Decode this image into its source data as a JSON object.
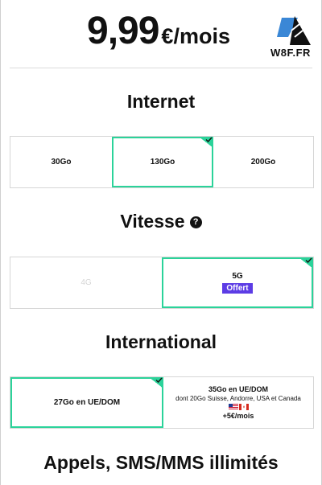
{
  "plan": {
    "price": "9,99",
    "unit": "€/mois"
  },
  "brand": {
    "logo_text": "W8F.FR"
  },
  "internet": {
    "title": "Internet",
    "options": [
      {
        "label": "30Go",
        "selected": false
      },
      {
        "label": "130Go",
        "selected": true
      },
      {
        "label": "200Go",
        "selected": false
      }
    ]
  },
  "speed": {
    "title": "Vitesse",
    "help_icon": "?",
    "options": [
      {
        "label": "4G",
        "selected": false,
        "disabled": true
      },
      {
        "label": "5G",
        "badge": "Offert",
        "selected": true
      }
    ]
  },
  "international": {
    "title": "International",
    "options": [
      {
        "label": "27Go en UE/DOM",
        "selected": true
      },
      {
        "label": "35Go en UE/DOM",
        "detail": "dont 20Go Suisse, Andorre, USA et Canada",
        "flags": [
          "us-flag",
          "canada-flag"
        ],
        "extra": "+5€/mois",
        "selected": false
      }
    ]
  },
  "calls": {
    "title": "Appels, SMS/MMS illimités"
  },
  "colors": {
    "accent": "#2bd39a",
    "badge": "#5c3ce5"
  }
}
